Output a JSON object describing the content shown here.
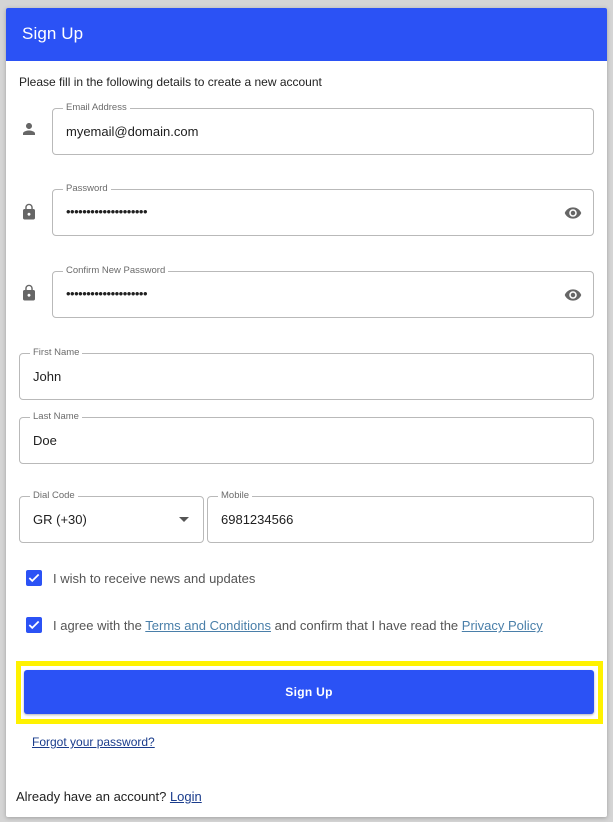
{
  "dialog": {
    "title": "Sign Up",
    "intro": "Please fill in the following details to create a new account"
  },
  "fields": {
    "email": {
      "label": "Email Address",
      "value": "myemail@domain.com",
      "icon": "person-icon"
    },
    "password": {
      "label": "Password",
      "value": "••••••••••••••••••••",
      "icon": "lock-icon",
      "toggle_icon": "eye-icon"
    },
    "confirm_password": {
      "label": "Confirm New Password",
      "value": "••••••••••••••••••••",
      "icon": "lock-icon",
      "toggle_icon": "eye-icon"
    },
    "first_name": {
      "label": "First Name",
      "value": "John"
    },
    "last_name": {
      "label": "Last Name",
      "value": "Doe"
    },
    "dial_code": {
      "label": "Dial Code",
      "value": "GR (+30)"
    },
    "mobile": {
      "label": "Mobile",
      "value": "6981234566"
    }
  },
  "checkboxes": {
    "news": {
      "label": "I wish to receive news and updates",
      "checked": true
    },
    "terms": {
      "prefix": "I agree with the ",
      "terms_link": "Terms and Conditions",
      "middle": " and confirm that I have read the ",
      "privacy_link": "Privacy Policy",
      "checked": true
    }
  },
  "actions": {
    "signup_label": "Sign Up",
    "forgot_label": "Forgot your password?"
  },
  "footer": {
    "text": "Already have an account? ",
    "login_label": "Login"
  },
  "colors": {
    "primary": "#2b52f5",
    "highlight": "#fff200",
    "link": "#4a7fa9"
  }
}
